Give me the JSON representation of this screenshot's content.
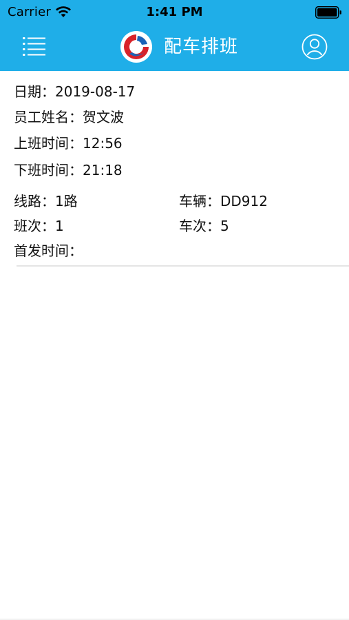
{
  "status_bar": {
    "carrier": "Carrier",
    "time": "1:41 PM"
  },
  "header": {
    "title": "配车排班",
    "background_color": "#1faee8",
    "menu_icon": "list-menu-icon",
    "logo_icon": "app-logo-icon",
    "profile_icon": "user-profile-icon"
  },
  "details": {
    "date": {
      "label": "日期：",
      "value": "2019-08-17"
    },
    "employee_name": {
      "label": "员工姓名：",
      "value": "贺文波"
    },
    "start_time": {
      "label": "上班时间：",
      "value": "12:56"
    },
    "end_time": {
      "label": "下班时间：",
      "value": "21:18"
    },
    "route": {
      "label": "线路：",
      "value": "1路"
    },
    "vehicle": {
      "label": "车辆：",
      "value": "DD912"
    },
    "shift": {
      "label": "班次：",
      "value": "1"
    },
    "trip": {
      "label": "车次：",
      "value": "5"
    },
    "first_departure": {
      "label": "首发时间：",
      "value": ""
    }
  }
}
